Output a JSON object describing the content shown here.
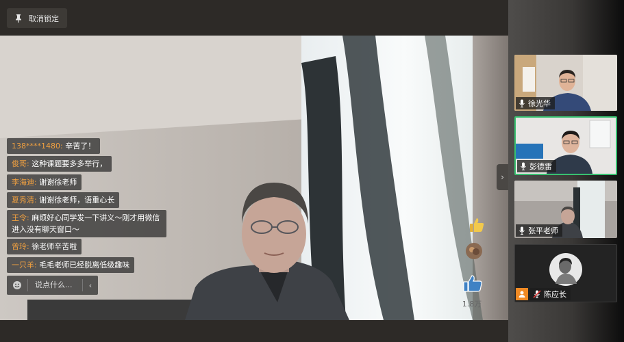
{
  "toolbar": {
    "unlock_label": "取消锁定"
  },
  "chat": {
    "messages": [
      {
        "name": "138****1480:",
        "text": "辛苦了！"
      },
      {
        "name": "俊哥:",
        "text": "这种课题要多多举行，"
      },
      {
        "name": "李海迪:",
        "text": "谢谢徐老师"
      },
      {
        "name": "夏秀清:",
        "text": "谢谢徐老师，语重心长"
      },
      {
        "name": "王令:",
        "text": "麻烦好心同学发一下讲义～刚才用微信进入没有聊天窗口～"
      },
      {
        "name": "曾玲:",
        "text": "徐老师辛苦啦"
      },
      {
        "name": "一只羊:",
        "text": "毛毛老师已经脱离低级趣味"
      }
    ],
    "input_placeholder": "说点什么...",
    "emoji_icon": "smiley-icon",
    "collapse_glyph": "‹"
  },
  "reactions": {
    "like_count": "1.8万"
  },
  "expand_glyph": "›",
  "participants": [
    {
      "name": "徐光华",
      "mic": "mic-on"
    },
    {
      "name": "彭德雷",
      "mic": "mic-on",
      "active": true
    },
    {
      "name": "张平老师",
      "mic": "mic-on"
    },
    {
      "name": "陈应长",
      "mic": "mic-muted"
    }
  ],
  "colors": {
    "chat_name": "#f0a040",
    "active_border": "#38c070",
    "like_blue": "#3f82c4"
  }
}
